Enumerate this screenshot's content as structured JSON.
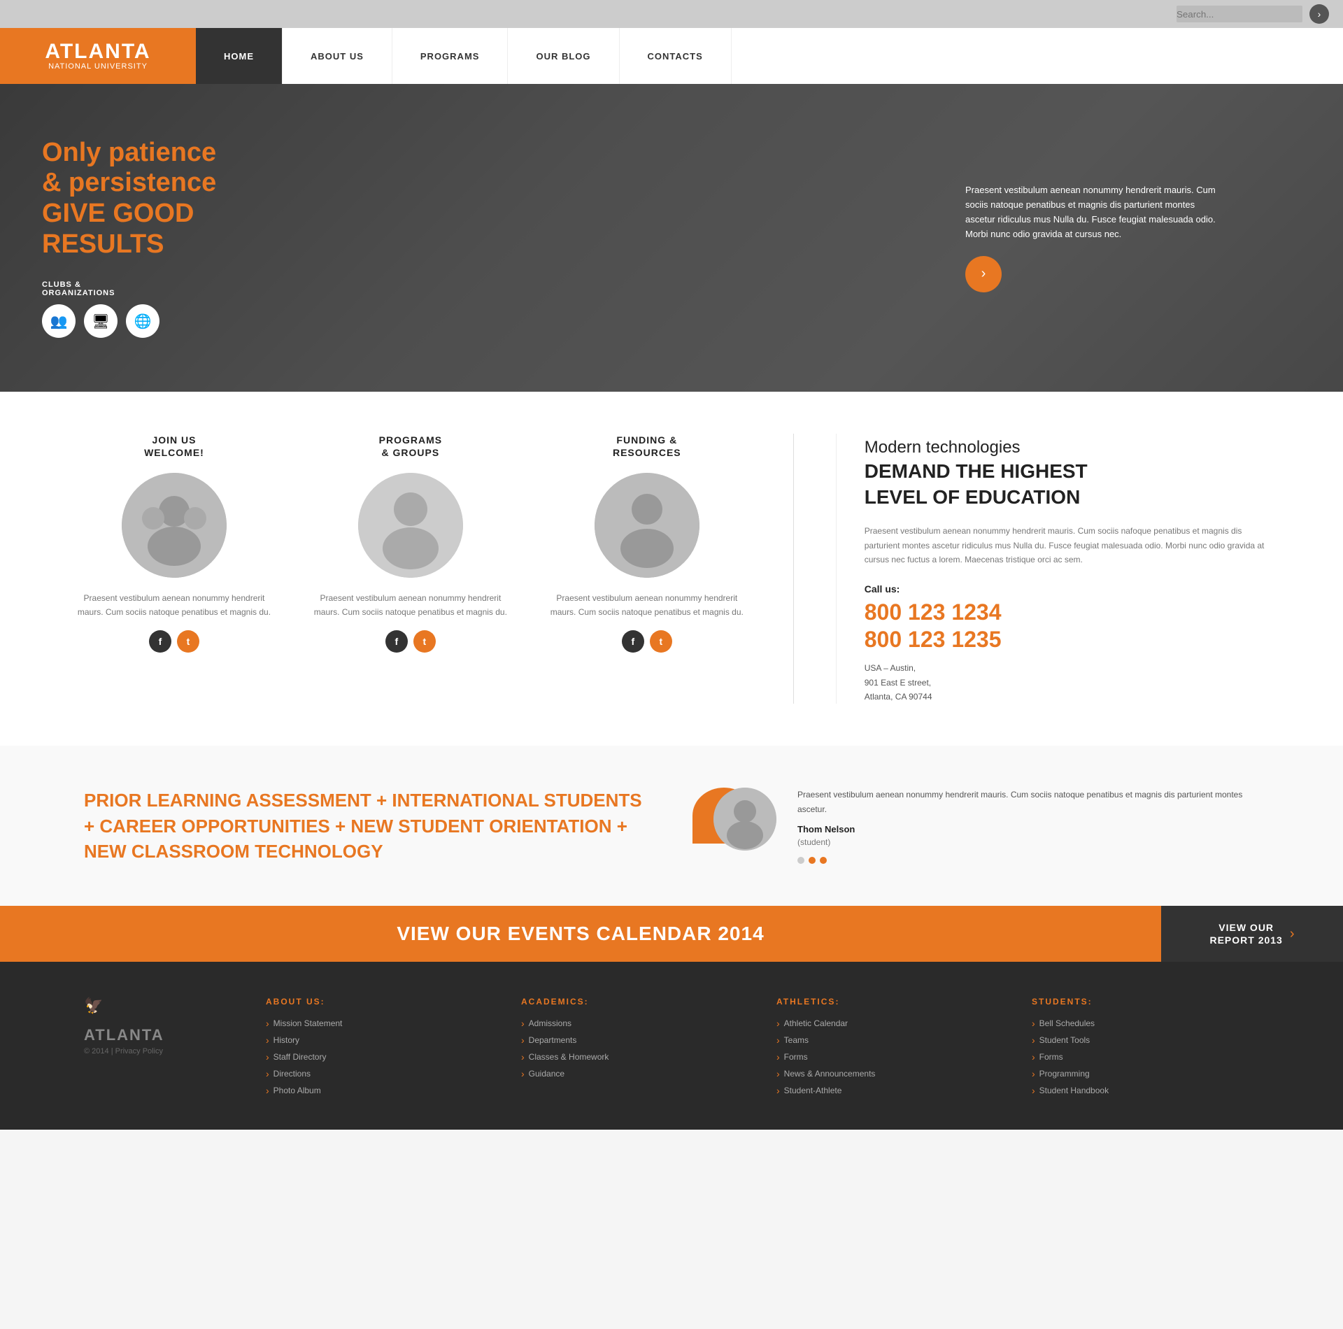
{
  "topbar": {
    "search_placeholder": "Search...",
    "arrow_label": "›"
  },
  "header": {
    "logo_brand": "ATLANTA",
    "logo_sub": "NATIONAL UNIVERSITY",
    "nav_items": [
      {
        "label": "HOME",
        "active": true
      },
      {
        "label": "ABOUT US"
      },
      {
        "label": "PROGRAMS"
      },
      {
        "label": "OUR BLOG"
      },
      {
        "label": "CONTACTS"
      }
    ]
  },
  "hero": {
    "title_line1": "Only patience",
    "title_line2": "& persistence",
    "title_line3": "GIVE GOOD",
    "title_line4": "RESULTS",
    "clubs_label": "CLUBS &\nORGANIZATIONS",
    "description": "Praesent vestibulum aenean nonummy hendrerit mauris. Cum sociis natoque penatibus et magnis dis parturient montes ascetur ridiculus mus Nulla du. Fusce feugiat malesuada odio. Morbi nunc odio gravida at cursus nec.",
    "arrow_icon": "›"
  },
  "cards": [
    {
      "title": "JOIN US\nWELCOME!",
      "text": "Praesent vestibulum aenean nonummy hendrerit maurs. Cum sociis natoque penatibus et magnis du."
    },
    {
      "title": "PROGRAMS\n& GROUPS",
      "text": "Praesent vestibulum aenean nonummy hendrerit maurs. Cum sociis natoque penatibus et magnis du."
    },
    {
      "title": "FUNDING &\nRESOURCES",
      "text": "Praesent vestibulum aenean nonummy hendrerit maurs. Cum sociis natoque penatibus et magnis du."
    }
  ],
  "section_right": {
    "title_line1": "Modern technologies",
    "title_line2": "DEMAND THE HIGHEST",
    "title_line3": "LEVEL OF EDUCATION",
    "text": "Praesent vestibulum aenean nonummy hendrerit mauris. Cum sociis nafoque penatibus et magnis dis parturient montes ascetur ridiculus mus Nulla du. Fusce feugiat malesuada odio. Morbi nunc odio gravida at cursus nec fuctus a lorem. Maecenas tristique orci ac sem.",
    "call_label": "Call us:",
    "phone1": "800 123 1234",
    "phone2": "800 123 1235",
    "address": "USA – Austin,\n901 East E street,\nAtlanta, CA 90744"
  },
  "marquee": {
    "title": "PRIOR LEARNING ASSESSMENT + INTERNATIONAL STUDENTS + CAREER OPPORTUNITIES + NEW STUDENT ORIENTATION + NEW CLASSROOM TECHNOLOGY",
    "quote_icon": "“",
    "testimonial_text": "Praesent vestibulum aenean nonummy hendrerit mauris. Cum sociis natoque penatibus et magnis dis parturient montes ascetur.",
    "person_name": "Thom Nelson",
    "person_role": "(student)"
  },
  "cta": {
    "main_text": "VIEW OUR EVENTS CALENDAR 2014",
    "secondary_text": "VIEW OUR\nREPORT 2013",
    "arrow": "›"
  },
  "footer": {
    "logo_text": "ATLANTA",
    "copyright": "© 2014 | Privacy Policy",
    "columns": [
      {
        "title": "ABOUT US:",
        "links": [
          "Mission Statement",
          "History",
          "Staff Directory",
          "Directions",
          "Photo Album"
        ]
      },
      {
        "title": "ACADEMICS:",
        "links": [
          "Admissions",
          "Departments",
          "Classes & Homework",
          "Guidance"
        ]
      },
      {
        "title": "ATHLETICS:",
        "links": [
          "Athletic Calendar",
          "Teams",
          "Forms",
          "News & Announcements",
          "Student-Athlete"
        ]
      },
      {
        "title": "STUDENTS:",
        "links": [
          "Bell Schedules",
          "Student Tools",
          "Forms",
          "Programming",
          "Student Handbook"
        ]
      }
    ]
  }
}
